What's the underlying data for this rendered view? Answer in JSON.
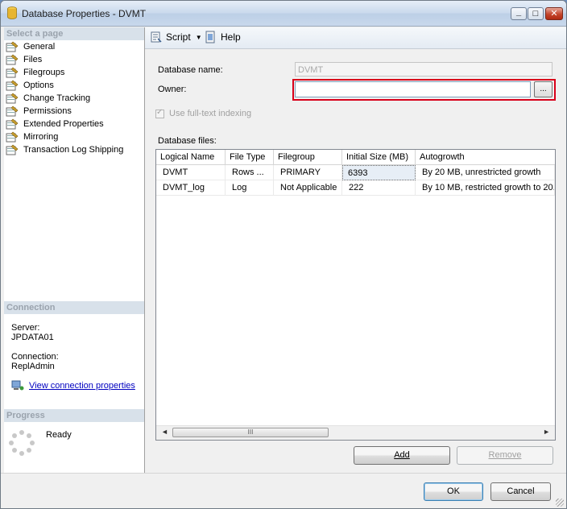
{
  "window": {
    "title": "Database Properties - DVMT",
    "min_icon": "minimize-icon",
    "max_icon": "maximize-icon",
    "close_icon": "close-icon"
  },
  "left": {
    "select_page_header": "Select a page",
    "pages": [
      "General",
      "Files",
      "Filegroups",
      "Options",
      "Change Tracking",
      "Permissions",
      "Extended Properties",
      "Mirroring",
      "Transaction Log Shipping"
    ],
    "connection_header": "Connection",
    "server_label": "Server:",
    "server_value": "JPDATA01",
    "connection_label": "Connection:",
    "connection_value": "ReplAdmin",
    "view_conn_link": "View connection properties",
    "progress_header": "Progress",
    "progress_status": "Ready"
  },
  "toolbar": {
    "script_label": "Script",
    "help_label": "Help"
  },
  "form": {
    "db_name_label": "Database name:",
    "db_name_value": "DVMT",
    "owner_label": "Owner:",
    "owner_value": "",
    "browse_label": "...",
    "fulltext_label": "Use full-text indexing",
    "db_files_label": "Database files:"
  },
  "grid": {
    "columns": [
      "Logical Name",
      "File Type",
      "Filegroup",
      "Initial Size (MB)",
      "Autogrowth"
    ],
    "rows": [
      [
        "DVMT",
        "Rows ...",
        "PRIMARY",
        "6393",
        "By 20 MB, unrestricted growth"
      ],
      [
        "DVMT_log",
        "Log",
        "Not Applicable",
        "222",
        "By 10 MB, restricted growth to 20..."
      ]
    ],
    "scroll_thumb": "III"
  },
  "buttons": {
    "add": "Add",
    "remove": "Remove",
    "ok": "OK",
    "cancel": "Cancel"
  }
}
